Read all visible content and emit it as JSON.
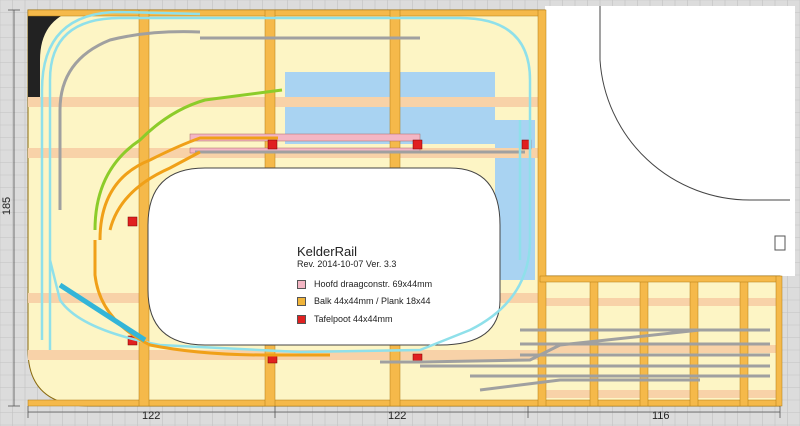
{
  "title": "KelderRail",
  "revision": "Rev. 2014-10-07 Ver. 3.3",
  "legend": [
    {
      "label": "Hoofd draagconstr. 69x44mm",
      "color": "#f4b6c4"
    },
    {
      "label": "Balk 44x44mm / Plank 18x44",
      "color": "#f0b43a"
    },
    {
      "label": "Tafelpoot 44x44mm",
      "color": "#e02020"
    }
  ],
  "dimensions": {
    "bottom": [
      "122",
      "122",
      "116"
    ],
    "side": "185"
  },
  "colors": {
    "background": "#dcdcdc",
    "grid_line": "#c2c2c2",
    "board": "#fdf5c5",
    "beam": "#f5b94a",
    "cross_member": "#f8d2a8",
    "main_beam": "#f4b6c4",
    "leg": "#e02020",
    "water": "#a9d3f2",
    "track_cyan": "#8fe0ea",
    "track_green": "#8ccc2a",
    "track_orange": "#f0a018",
    "track_gray": "#a0a0a0",
    "ramp_blue": "#33b5d8"
  }
}
